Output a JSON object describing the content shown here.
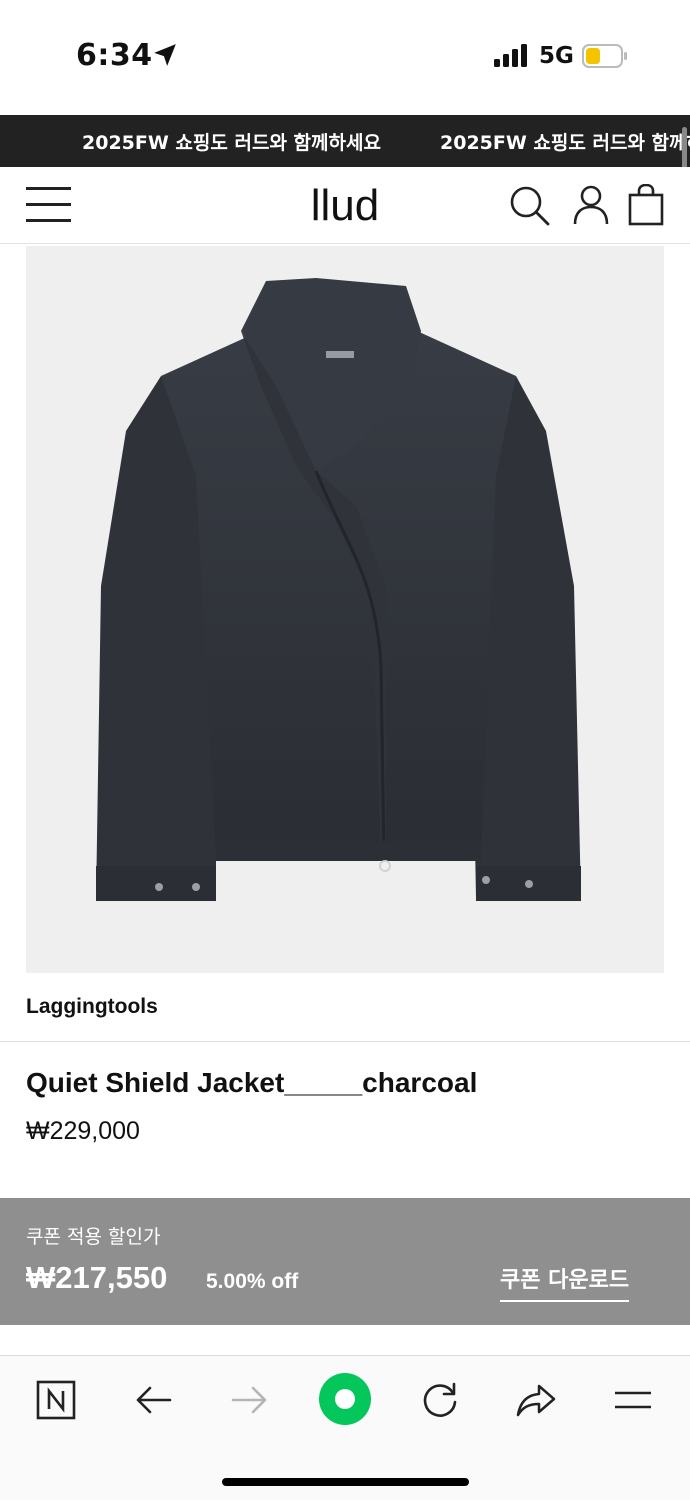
{
  "status_bar": {
    "time": "6:34",
    "network": "5G",
    "icons": [
      "location-arrow-icon",
      "cellular-signal-icon",
      "battery-icon"
    ],
    "battery_color": "#f5c400"
  },
  "banner": {
    "text": "2025FW 쇼핑도 러드와 함께하세요",
    "background": "#222222"
  },
  "header": {
    "logo": "llud",
    "icons": [
      "menu-icon",
      "search-icon",
      "account-icon",
      "shopping-bag-icon"
    ]
  },
  "product": {
    "brand": "Laggingtools",
    "name": "Quiet Shield Jacket_____charcoal",
    "price": "₩229,000",
    "image_subject": "charcoal jacket"
  },
  "coupon": {
    "label": "쿠폰 적용 할인가",
    "price": "₩217,550",
    "discount": "5.00% off",
    "download_label": "쿠폰 다운로드",
    "background": "#8f8f8f"
  },
  "browser_toolbar": {
    "icons": [
      "naver-n-icon",
      "back-arrow-icon",
      "forward-arrow-icon",
      "green-circle-icon",
      "reload-icon",
      "share-icon",
      "menu-icon"
    ],
    "accent": "#03c75a"
  }
}
